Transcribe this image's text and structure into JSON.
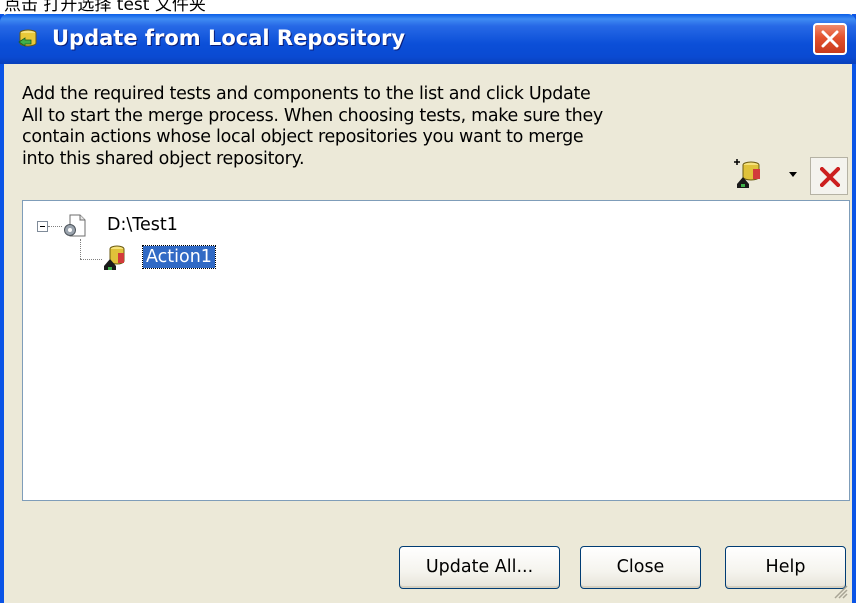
{
  "window": {
    "title": "Update from Local Repository"
  },
  "description": {
    "lines": [
      "Add the required tests and components to the list and click Update",
      "All to start the merge process. When choosing tests, make sure they",
      "contain actions whose local object repositories you want to merge",
      "into this shared object repository."
    ]
  },
  "toolbar": {
    "add_icon": "add-repository-icon",
    "dropdown_icon": "dropdown-arrow-icon",
    "remove_icon": "delete-x-icon"
  },
  "tree": {
    "root": {
      "label": "D:\\Test1",
      "icon": "test-document-icon",
      "expanded": true,
      "children": [
        {
          "label": "Action1",
          "icon": "action-repository-icon",
          "selected": true
        }
      ]
    }
  },
  "buttons": {
    "update_all": "Update All...",
    "close": "Close",
    "help": "Help"
  },
  "colors": {
    "titlebar": "#0a4ad2",
    "dialog_bg": "#ece9d8",
    "selection": "#316ac5",
    "remove_red": "#cc1f1f"
  }
}
